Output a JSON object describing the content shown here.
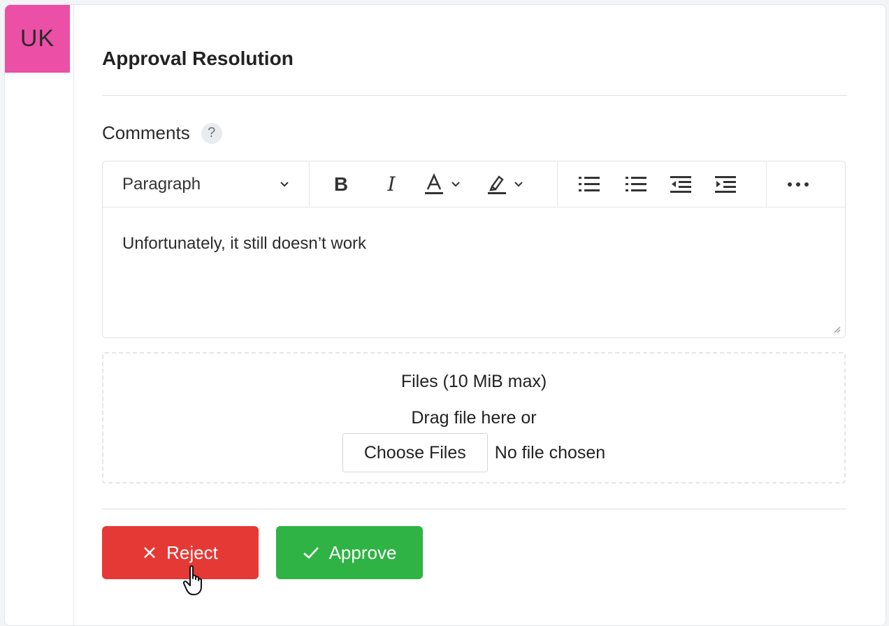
{
  "avatar": {
    "initials": "UK",
    "color": "#ec4fa6"
  },
  "section": {
    "title": "Approval Resolution"
  },
  "comments": {
    "label": "Comments",
    "help": "?",
    "toolbar": {
      "block_style": "Paragraph",
      "icons": [
        "bold-icon",
        "italic-icon",
        "text-color-icon",
        "highlight-icon",
        "bullet-list-icon",
        "numbered-list-icon",
        "outdent-icon",
        "indent-icon",
        "more-icon"
      ]
    },
    "text": "Unfortunately, it still doesn’t work"
  },
  "files": {
    "title": "Files (10 MiB max)",
    "drag_text": "Drag file here or",
    "choose_label": "Choose Files",
    "status": "No file chosen"
  },
  "actions": {
    "reject_label": "Reject",
    "approve_label": "Approve",
    "reject_color": "#e53935",
    "approve_color": "#2fb344"
  }
}
